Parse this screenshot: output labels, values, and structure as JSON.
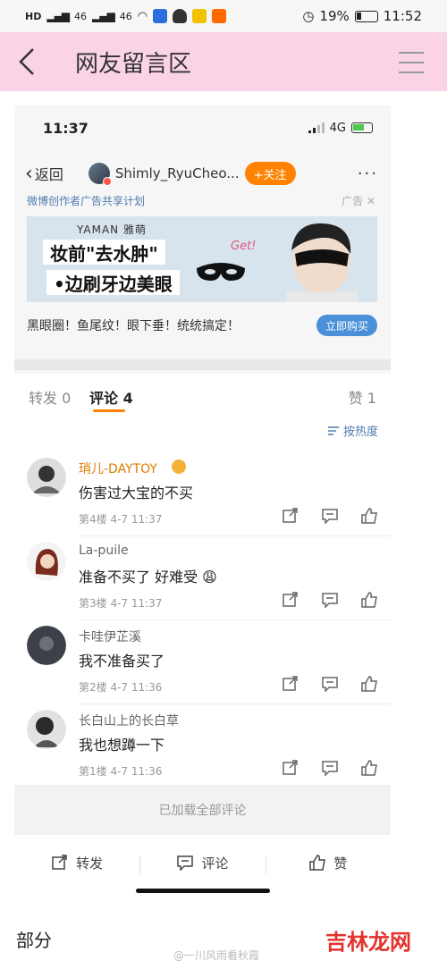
{
  "statusbar": {
    "network_left": "HD",
    "signal_a": "46",
    "signal_b": "46",
    "battery_percent": "19%",
    "time": "11:52"
  },
  "header": {
    "title": "网友留言区"
  },
  "inner": {
    "time": "11:37",
    "network": "4G",
    "back_label": "返回",
    "username": "Shimly_RyuCheo...",
    "follow_label": "+关注",
    "more": "···"
  },
  "ad": {
    "program": "微博创作者广告共享计划",
    "label": "广告 ✕",
    "brand": "YAMAN 雅萌",
    "line1": "妆前\"去水肿\"",
    "line2": "•边刷牙边美眼",
    "get_text": "Get!",
    "slogan": "黑眼圈！鱼尾纹！眼下垂！统统搞定！",
    "buy_label": "立即购买"
  },
  "tabs": {
    "repost": "转发 0",
    "comment": "评论 4",
    "like": "赞 1"
  },
  "sort_label": "按热度",
  "comments": [
    {
      "name": "琑儿-DAYTOY",
      "text": "伤害过大宝的不买",
      "meta": "第4楼  4-7 11:37"
    },
    {
      "name": "La-puile",
      "text": "准备不买了 好难受 😩",
      "meta": "第3楼  4-7 11:37"
    },
    {
      "name": "卡哇伊芷溪",
      "text": "我不准备买了",
      "meta": "第2楼  4-7 11:36"
    },
    {
      "name": "长白山上的长白草",
      "text": "我也想蹲一下",
      "meta": "第1楼  4-7 11:36"
    }
  ],
  "loaded_all": "已加载全部评论",
  "actionbar": {
    "repost": "转发",
    "comment": "评论",
    "like": "赞"
  },
  "footer": {
    "left": "部分",
    "watermark": "@一川风雨看秋霞",
    "brand": "吉林龙网"
  },
  "colors": {
    "header_bg": "#fbd3e6",
    "accent_orange": "#ff8200",
    "link_blue": "#4e7cb0",
    "brand_red": "#e4322d"
  }
}
